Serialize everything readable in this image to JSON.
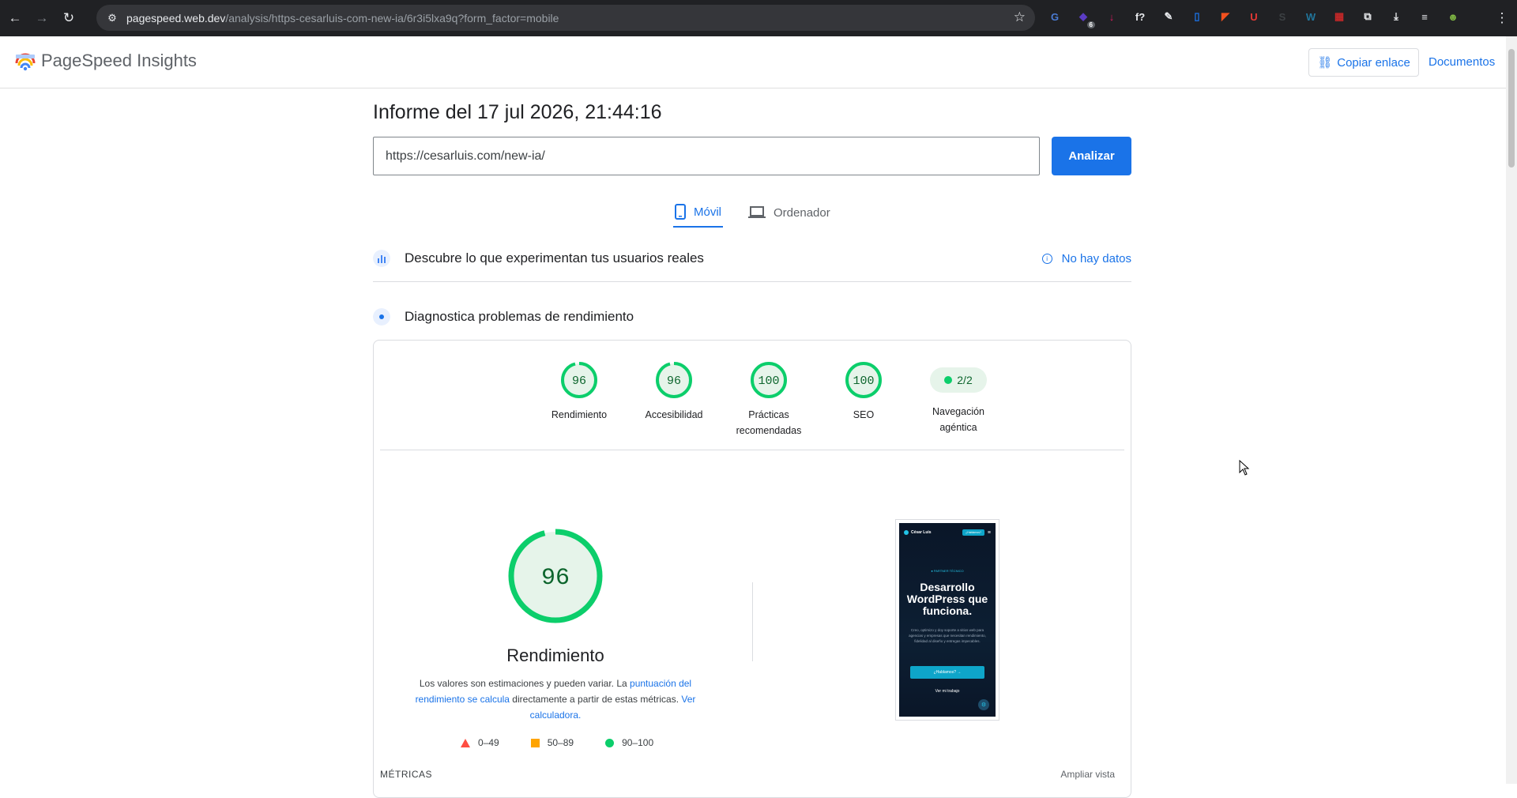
{
  "browser": {
    "url_host": "pagespeed.web.dev",
    "url_path": "/analysis/https-cesarluis-com-new-ia/6r3i5lxa9q?form_factor=mobile",
    "extensions": [
      {
        "name": "translate-ext",
        "glyph": "G",
        "color": "#4a7bd3"
      },
      {
        "name": "purple-ext",
        "glyph": "◆",
        "color": "#5b3cc4",
        "badge": "6"
      },
      {
        "name": "download-ext",
        "glyph": "↓",
        "color": "#d81b60"
      },
      {
        "name": "font-ext",
        "glyph": "f?",
        "color": "#202124"
      },
      {
        "name": "picker-ext",
        "glyph": "✎",
        "color": "#202124"
      },
      {
        "name": "doc-ext",
        "glyph": "▯",
        "color": "#1a73e8"
      },
      {
        "name": "orange-ext",
        "glyph": "◤",
        "color": "#f4511e"
      },
      {
        "name": "shield-ext",
        "glyph": "U",
        "color": "#e53935"
      },
      {
        "name": "s-ext",
        "glyph": "S",
        "color": "#3c4043"
      },
      {
        "name": "wordpress-ext",
        "glyph": "W",
        "color": "#21759b"
      },
      {
        "name": "dev-ext",
        "glyph": "▦",
        "color": "#c62828"
      },
      {
        "name": "puzzle-ext",
        "glyph": "⧉",
        "color": "#202124"
      },
      {
        "name": "downloads-ext",
        "glyph": "⤓",
        "color": "#202124"
      },
      {
        "name": "queue-ext",
        "glyph": "≡",
        "color": "#202124"
      },
      {
        "name": "profile-ext",
        "glyph": "☻",
        "color": "#7cb342"
      }
    ]
  },
  "header": {
    "title": "PageSpeed Insights",
    "copy_link": "Copiar enlace",
    "docs": "Documentos"
  },
  "report": {
    "title": "Informe del 17 jul 2026, 21:44:16",
    "url_value": "https://cesarluis.com/new-ia/",
    "analyze": "Analizar"
  },
  "tabs": [
    {
      "label": "Móvil",
      "active": true
    },
    {
      "label": "Ordenador",
      "active": false
    }
  ],
  "sections": {
    "real_users": "Descubre lo que experimentan tus usuarios reales",
    "no_data": "No hay datos",
    "diagnose": "Diagnostica problemas de rendimiento"
  },
  "scores": [
    {
      "label": "Rendimiento",
      "value": "96"
    },
    {
      "label": "Accesibilidad",
      "value": "96"
    },
    {
      "label": "Prácticas recomendadas",
      "value": "100"
    },
    {
      "label": "SEO",
      "value": "100"
    },
    {
      "label": "Navegación agéntica",
      "value": "2/2"
    }
  ],
  "performance": {
    "score": "96",
    "label": "Rendimiento",
    "explain_1": "Los valores son estimaciones y pueden variar. La ",
    "explain_link1": "puntuación del rendimiento se calcula",
    "explain_2": " directamente a partir de estas métricas. ",
    "explain_link2": "Ver calculadora.",
    "legend": [
      "0–49",
      "50–89",
      "90–100"
    ]
  },
  "preview": {
    "brand": "César Luis",
    "nav_btn": "¿Hablamos?",
    "eyebrow": "● PARTNER TÉCNICO",
    "headline": "Desarrollo WordPress que funciona.",
    "body": "Creo, optimizo y doy soporte a sitios web para agencias y empresas que necesitan rendimiento, fidelidad al diseño y entregas impecables.",
    "cta": "¿Hablamos? →",
    "link": "Ver mi trabajo"
  },
  "metrics": {
    "label": "MÉTRICAS",
    "expand": "Ampliar vista"
  },
  "colors": {
    "pass": "#0cce6b",
    "pass_fill": "#e6f4ea",
    "pass_text": "#0d652d",
    "accent": "#1a73e8"
  }
}
